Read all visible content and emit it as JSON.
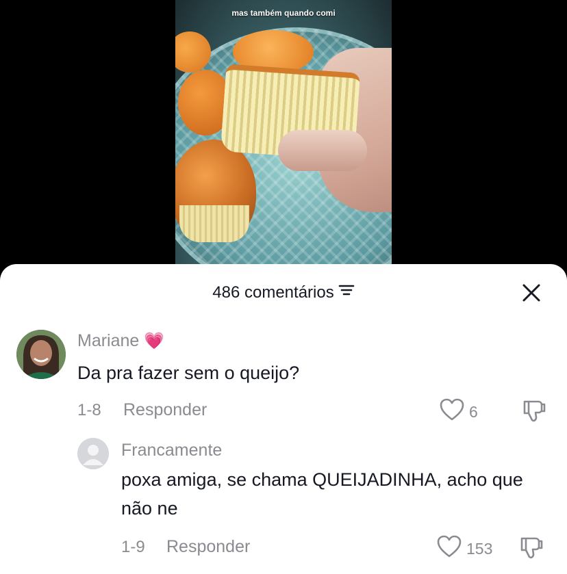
{
  "video": {
    "caption": "mas também quando comi"
  },
  "sheet": {
    "title": "486 comentários",
    "sort_icon": "sort-lines-icon",
    "close_icon": "close-icon"
  },
  "comments": [
    {
      "author": "Mariane",
      "author_emoji": "💗",
      "text": "Da pra fazer sem o queijo?",
      "date": "1-8",
      "reply_label": "Responder",
      "likes": "6"
    },
    {
      "author": "Francamente",
      "text": "poxa amiga, se chama QUEIJADINHA, acho que não ne",
      "date": "1-9",
      "reply_label": "Responder",
      "likes": "153"
    }
  ],
  "colors": {
    "text_primary": "#161823",
    "text_secondary": "#8a8b91",
    "sheet_bg": "#ffffff",
    "backdrop": "#000000"
  }
}
